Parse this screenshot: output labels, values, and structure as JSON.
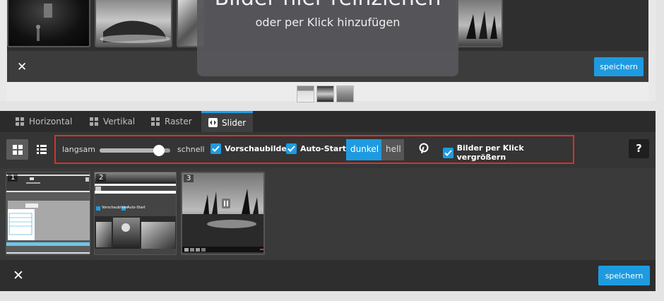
{
  "top_editor": {
    "drop_title": "Bilder hier reinziehen",
    "drop_subtitle": "oder per Klick hinzufügen",
    "close_icon": "x-icon",
    "save_label": "speichern"
  },
  "tabs": [
    {
      "label": "Horizontal",
      "icon": "grid-icon",
      "active": false
    },
    {
      "label": "Vertikal",
      "icon": "grid-icon",
      "active": false
    },
    {
      "label": "Raster",
      "icon": "grid-icon",
      "active": false
    },
    {
      "label": "Slider",
      "icon": "slider-icon",
      "active": true
    }
  ],
  "toolbar": {
    "view_grid_icon": "grid-view-icon",
    "view_list_icon": "list-view-icon",
    "speed_slow_label": "langsam",
    "speed_fast_label": "schnell",
    "speed_value_percent": 84,
    "thumbnails_label": "Vorschaubilder",
    "thumbnails_checked": true,
    "autostart_label": "Auto-Start",
    "autostart_checked": true,
    "theme_dark_label": "dunkel",
    "theme_light_label": "hell",
    "theme_selected": "dunkel",
    "pinterest_icon": "pinterest-icon",
    "enlarge_label": "Bilder per Klick vergrößern",
    "enlarge_checked": true,
    "help_label": "?"
  },
  "thumbnails": [
    {
      "number": "1"
    },
    {
      "number": "2",
      "mini_check_1": "Vorschaubilder",
      "mini_check_2": "Auto-Start"
    },
    {
      "number": "3"
    }
  ],
  "bottom_bar": {
    "close_icon": "x-icon",
    "save_label": "speichern"
  },
  "colors": {
    "accent": "#1e9be0",
    "highlight_border": "#d8312b"
  }
}
